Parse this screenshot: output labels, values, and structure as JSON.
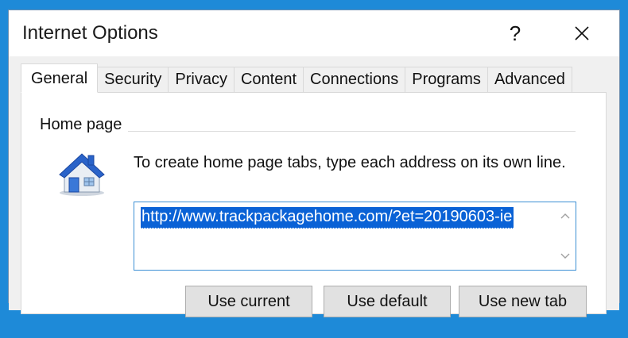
{
  "window": {
    "title": "Internet Options",
    "help_label": "?"
  },
  "tabs": [
    {
      "label": "General",
      "active": true
    },
    {
      "label": "Security",
      "active": false
    },
    {
      "label": "Privacy",
      "active": false
    },
    {
      "label": "Content",
      "active": false
    },
    {
      "label": "Connections",
      "active": false
    },
    {
      "label": "Programs",
      "active": false
    },
    {
      "label": "Advanced",
      "active": false
    }
  ],
  "home_page": {
    "group_label": "Home page",
    "instruction": "To create home page tabs, type each address on its own line.",
    "url": "http://www.trackpackagehome.com/?et=20190603-ie",
    "buttons": {
      "use_current": "Use current",
      "use_default": "Use default",
      "use_new_tab": "Use new tab"
    }
  },
  "icons": {
    "help": "help-icon",
    "close": "close-icon",
    "home": "house-icon",
    "scroll_up": "chevron-up-icon",
    "scroll_down": "chevron-down-icon"
  },
  "colors": {
    "selection": "#0a62d6",
    "focus_border": "#3c8fd4",
    "dialog_bg": "#f0f0f0"
  }
}
